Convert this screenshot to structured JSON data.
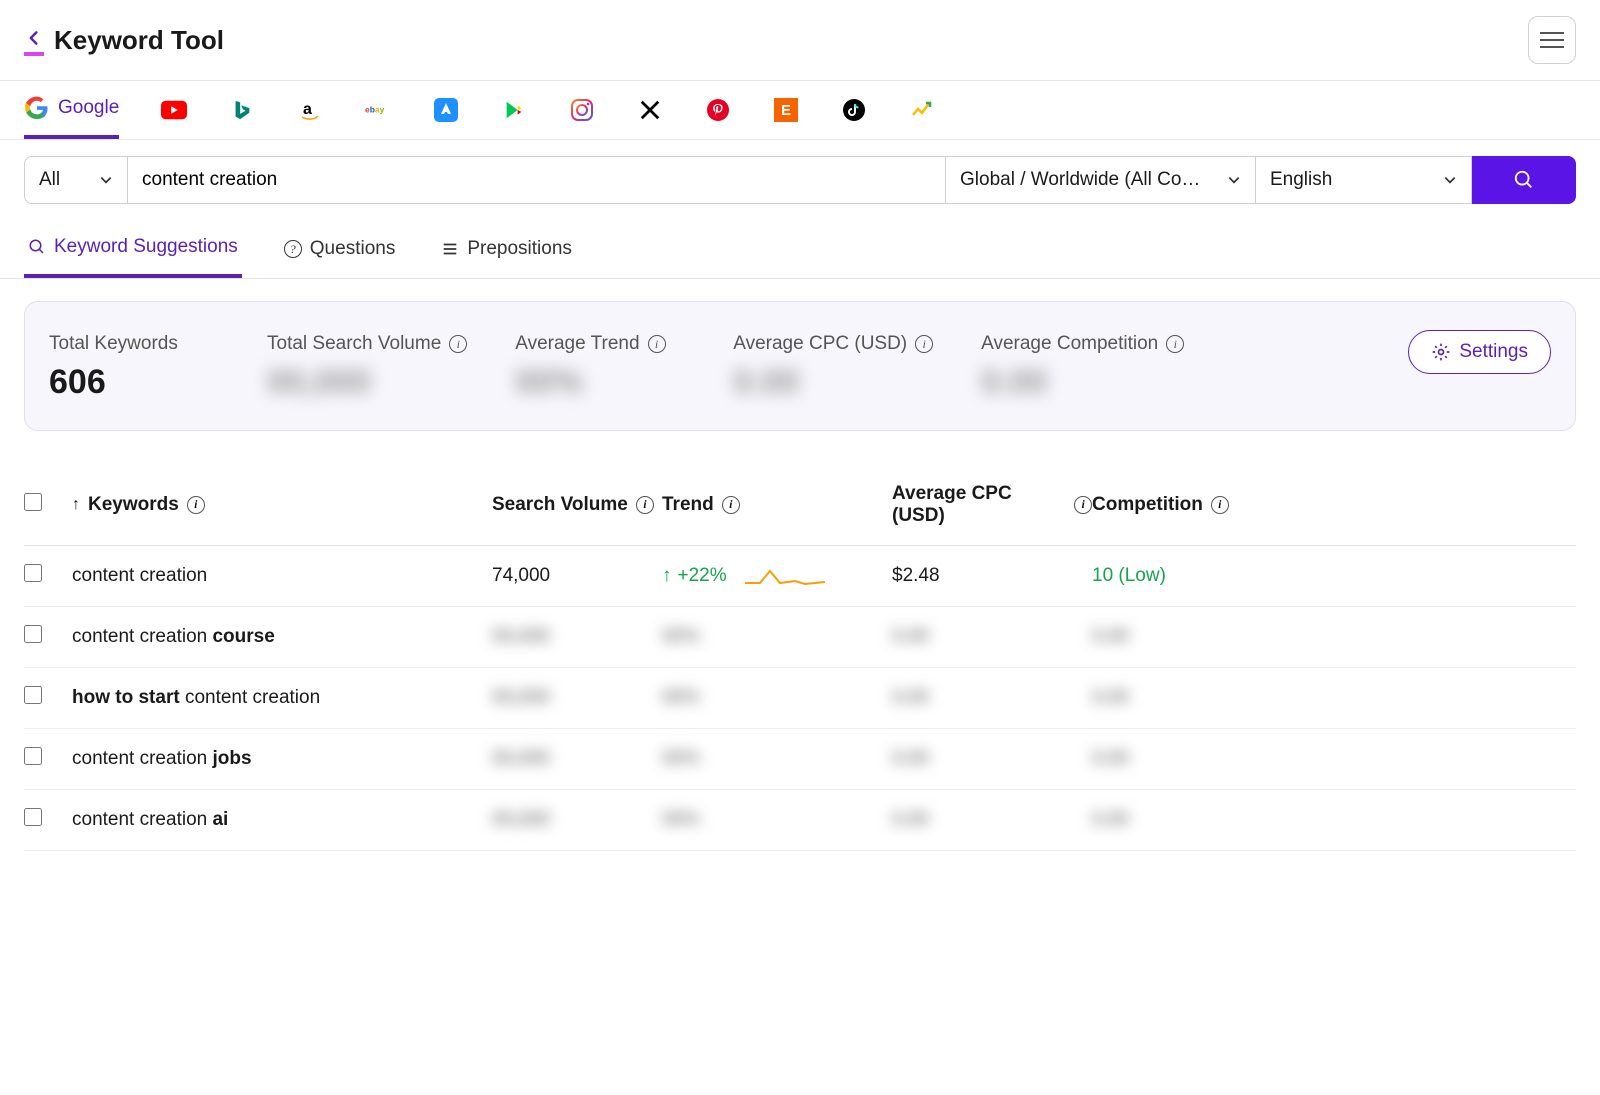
{
  "app": {
    "title": "Keyword Tool"
  },
  "platforms": {
    "active_label": "Google",
    "items": [
      "google",
      "youtube",
      "bing",
      "amazon",
      "ebay",
      "appstore",
      "playstore",
      "instagram",
      "x",
      "pinterest",
      "etsy",
      "tiktok",
      "trends"
    ]
  },
  "search": {
    "filter_label": "All",
    "query": "content creation",
    "region": "Global / Worldwide (All Co…",
    "language": "English"
  },
  "tabs": {
    "suggestions": "Keyword Suggestions",
    "questions": "Questions",
    "prepositions": "Prepositions"
  },
  "stats": {
    "total_keywords_label": "Total Keywords",
    "total_keywords_value": "606",
    "total_search_volume_label": "Total Search Volume",
    "total_search_volume_value": "00,000",
    "avg_trend_label": "Average Trend",
    "avg_trend_value": "00%",
    "avg_cpc_label": "Average CPC (USD)",
    "avg_cpc_value": "0.00",
    "avg_comp_label": "Average Competition",
    "avg_comp_value": "0.00",
    "settings_label": "Settings"
  },
  "table": {
    "headers": {
      "keywords": "Keywords",
      "search_volume": "Search Volume",
      "trend": "Trend",
      "avg_cpc": "Average CPC (USD)",
      "competition": "Competition"
    },
    "rows": [
      {
        "keyword_prefix": "",
        "keyword_bold": "",
        "keyword_plain": "content creation",
        "search_volume": "74,000",
        "trend": "+22%",
        "cpc": "$2.48",
        "competition": "10 (Low)",
        "blurred": false
      },
      {
        "keyword_prefix": "content creation ",
        "keyword_bold": "course",
        "keyword_plain": "",
        "search_volume": "00,000",
        "trend": "00%",
        "cpc": "0.00",
        "competition": "0.00",
        "blurred": true
      },
      {
        "keyword_prefix": "",
        "keyword_bold": "how to start",
        "keyword_plain": " content creation",
        "search_volume": "00,000",
        "trend": "00%",
        "cpc": "0.00",
        "competition": "0.00",
        "blurred": true
      },
      {
        "keyword_prefix": "content creation ",
        "keyword_bold": "jobs",
        "keyword_plain": "",
        "search_volume": "00,000",
        "trend": "00%",
        "cpc": "0.00",
        "competition": "0.00",
        "blurred": true
      },
      {
        "keyword_prefix": "content creation ",
        "keyword_bold": "ai",
        "keyword_plain": "",
        "search_volume": "00,000",
        "trend": "00%",
        "cpc": "0.00",
        "competition": "0.00",
        "blurred": true
      }
    ]
  }
}
